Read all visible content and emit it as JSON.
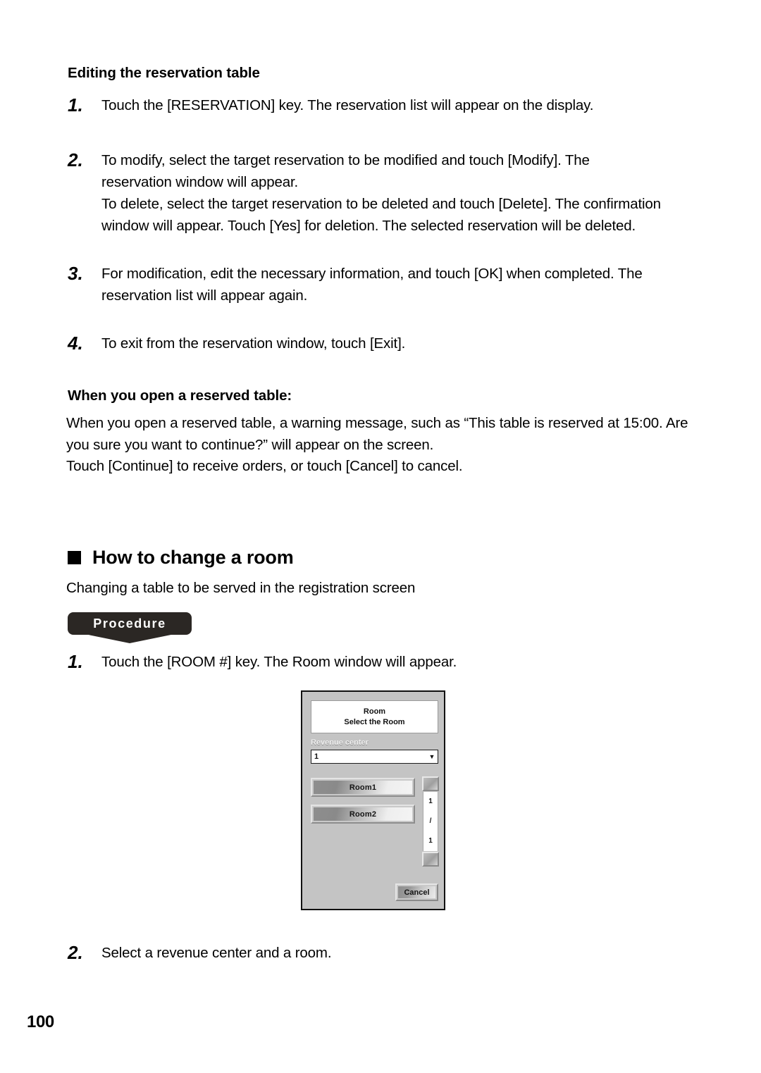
{
  "document": {
    "page_number": "100"
  },
  "section_editing": {
    "heading": "Editing the reservation table",
    "steps": [
      {
        "number": "1.",
        "text": "Touch the [RESERVATION] key.  The reservation list will appear on the display."
      },
      {
        "number": "2.",
        "text": "To modify, select the target reservation to be modified and touch [Modify].  The reservation window will appear."
      },
      {
        "number": "3.",
        "text": "For modification, edit the necessary information, and touch [OK] when completed.  The reservation list will appear again."
      },
      {
        "number": "4.",
        "text": "To exit from the reservation window, touch [Exit]."
      }
    ],
    "delete_paragraph": "To delete, select the target reservation to be deleted and touch [Delete].  The confirmation window will appear.  Touch [Yes] for deletion. The selected reservation will be deleted."
  },
  "section_reserved_table": {
    "heading": "When you open a reserved table:",
    "paragraph": "When you open a reserved table, a warning message, such as “This table is reserved at 15:00.  Are you sure you want to continue?” will appear on the screen.\nTouch [Continue] to receive orders, or touch [Cancel] to cancel."
  },
  "section_change_room": {
    "title": "How to change a room",
    "intro": "Changing a table to be served in the registration screen",
    "procedure_badge": "Procedure",
    "steps": [
      {
        "number": "1.",
        "text": "Touch the [ROOM #] key.  The Room window will appear."
      },
      {
        "number": "2.",
        "text": "Select a revenue center and a room."
      }
    ]
  },
  "room_dialog": {
    "title": "Room",
    "subtitle": "Select the Room",
    "field_label": "Revenue center",
    "combo_value": "1",
    "combo_arrow_icon": "chevron-down-icon",
    "room_buttons": [
      "Room1",
      "Room2"
    ],
    "pager": {
      "current": "1",
      "separator": "/",
      "total": "1",
      "up_icon": "scroll-up-button",
      "down_icon": "scroll-down-button"
    },
    "cancel_label": "Cancel"
  },
  "colors": {
    "ink": "#000000",
    "badge_bg": "#2b2724",
    "dialog_bg": "#c4c4c4",
    "dialog_border": "#111111",
    "field_bg": "#ffffff"
  }
}
